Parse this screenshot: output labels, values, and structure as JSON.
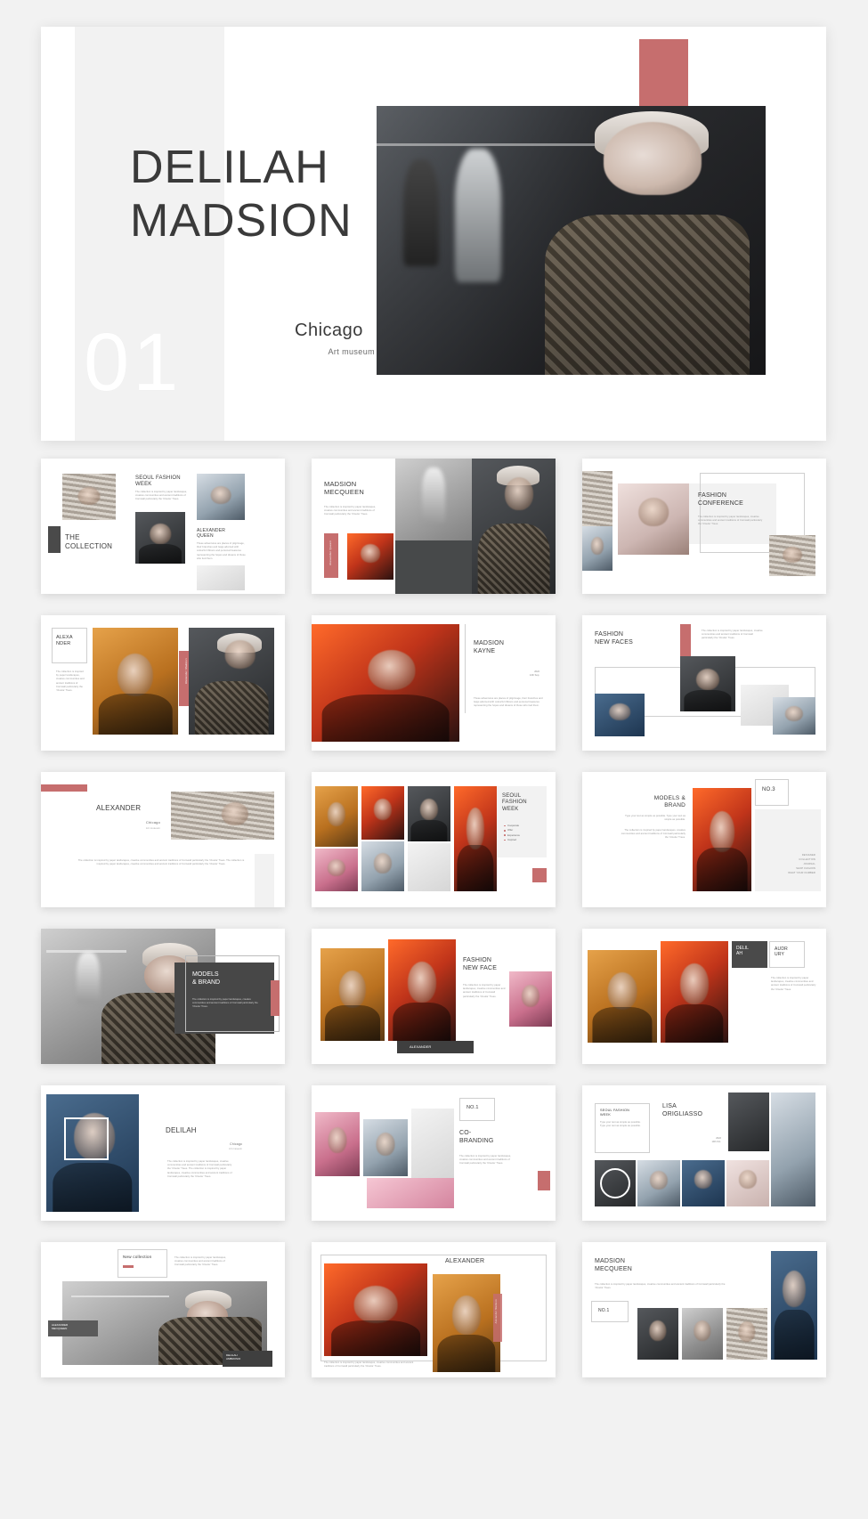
{
  "common": {
    "body_text": "The collection is inspired by paper landscapes, creative communities and ancient traditions of Cornwall particularly the 'Cloutie' Trees.",
    "body_text_long": "The collection is inspired by paper landscapes, creative communities and ancient traditions of Cornwall particularly the 'Cloutie' Trees. The collection is inspired by paper landscapes, creative communities and ancient traditions of Cornwall particularly the 'Cloutie' Trees.",
    "tip_text": "Type your text as simple as possible. Type your text as simple as possible.",
    "accent_color": "#c66e6e",
    "dark_color": "#4a4a4a",
    "text_color": "#3a3a3a"
  },
  "hero": {
    "title_line1": "DELILAH",
    "title_line2": "MADSION",
    "number": "01",
    "city": "Chicago",
    "venue": "Art museum"
  },
  "slides": [
    {
      "id": "the-collection",
      "title": "THE\nCOLLECTION",
      "heading": "SEOUL FASHION\nWEEK",
      "subheading": "ALEXANDER\nQUEEN",
      "body": "The collection is inspired by paper landscapes, creative communities and ancient traditions of Cornwall particularly the 'Cloutie' Trees.",
      "body2": "These adventures are places of pilgrimage, their branches and twigs adorned with colourful ribbons and personal treasures representing the hopes and dreams of those who tied them."
    },
    {
      "id": "madsion-mecqueen",
      "title": "MADSION\nMECQUEEN",
      "body": "The collection is inspired by paper landscapes, creative communities and ancient traditions of Cornwall particularly the 'Cloutie' Trees.",
      "ribbon": "Alexander Queen"
    },
    {
      "id": "fashion-conference",
      "title": "FASHION\nCONFERENCE",
      "body": "The collection is inspired by paper landscapes, creative communities and ancient traditions of Cornwall particularly the 'Cloutie' Trees."
    },
    {
      "id": "alexander-card",
      "title": "ALEXA\nNDER",
      "body": "The collection is inspired by paper landscapes, creative communities and ancient traditions of Cornwall particularly the 'Cloutie' Trees.",
      "ribbon": "Alexander Madsion"
    },
    {
      "id": "madsion-kayne",
      "title": "MADSION\nKAYNE",
      "date_year": "2022",
      "date_day": "12th Sep.",
      "body": "These adventures are places of pilgrimage, their branches and twigs adorned with colourful ribbons and personal treasures representing the hopes and dreams of those who tied them."
    },
    {
      "id": "fashion-new-faces",
      "title": "FASHION\nNEW FACES",
      "body": "The collection is inspired by paper landscapes, creative communities and ancient traditions of Cornwall particularly the 'Cloutie' Trees."
    },
    {
      "id": "alexander-chicago",
      "title": "ALEXANDER",
      "city": "Chicago",
      "venue": "Art museum",
      "body": "The collection is inspired by paper landscapes, creative communities and ancient traditions of Cornwall particularly the 'Cloutie' Trees. The collection is inspired by paper landscapes, creative communities and ancient traditions of Cornwall particularly the 'Cloutie' Trees."
    },
    {
      "id": "seoul-fashion-week-list",
      "title": "SEOUL\nFASHION\nWEEK",
      "bullets": [
        "Cooperate",
        "Offer",
        "Experience",
        "Inspired"
      ]
    },
    {
      "id": "models-brand-no3",
      "title": "MODELS &\nBRAND",
      "badge": "NO.3",
      "body": "Type your text as simple as possible. Type your text as simple as possible.",
      "body2": "The collection is inspired by paper landscapes, creative communities and ancient traditions of Cornwall particularly the 'Cloutie' Trees.",
      "list": [
        "DESIGNER",
        "COLLECTION",
        "JOURNAL",
        "SHOP FASHION",
        "WHAT YOUR NUMBER"
      ]
    },
    {
      "id": "models-brand",
      "title": "MODELS\n& BRAND",
      "body": "The collection is inspired by paper landscapes, creative communities and ancient traditions of Cornwall particularly the 'Cloutie' Trees."
    },
    {
      "id": "fashion-new-face",
      "title": "FASHION\nNEW FACE",
      "caption": "ALEXANDER",
      "body": "The collection is inspired by paper landscapes, creative communities and ancient traditions of Cornwall particularly the 'Cloutie' Trees."
    },
    {
      "id": "delilah-audrury",
      "tag_left": "DELIL\nAH",
      "tag_right": "AUDR\nURY",
      "body": "The collection is inspired by paper landscapes, creative communities and ancient traditions of Cornwall particularly the 'Cloutie' Trees."
    },
    {
      "id": "delilah-portrait",
      "title": "DELILAH",
      "city": "Chicago",
      "venue": "Art museum",
      "body": "The collection is inspired by paper landscapes, creative communities and ancient traditions of Cornwall particularly the 'Cloutie' Trees. The collection is inspired by paper landscapes, creative communities and ancient traditions of Cornwall particularly the 'Cloutie' Trees."
    },
    {
      "id": "co-branding",
      "badge": "NO.1",
      "title": "CO-\nBRANDING",
      "body": "The collection is inspired by paper landscapes, creative communities and ancient traditions of Cornwall particularly the 'Cloutie' Trees."
    },
    {
      "id": "lisa-origliasso",
      "title": "LISA\nORIGLIASSO",
      "panel_title": "SEOUL FASHION\nWEEK",
      "panel_body": "Type your text as simple as possible. Type your text as simple as possible.",
      "date_year": "2022",
      "date_day": "10th Oct."
    },
    {
      "id": "new-collection",
      "badge": "New collection",
      "tag_left": "ALEXANDER\nMECQUEEN",
      "tag_right": "DELILAH\nAMBROSIO",
      "body": "The collection is inspired by paper landscapes, creative communities and ancient traditions of Cornwall particularly the 'Cloutie' Trees."
    },
    {
      "id": "alexander-wide",
      "title": "ALEXANDER",
      "body": "The collection is inspired by paper landscapes, creative communities and ancient traditions of Cornwall particularly the 'Cloutie' Trees.",
      "ribbon": "Alexander Madsion"
    },
    {
      "id": "madsion-mecqueen-2",
      "title": "MADSION\nMECQUEEN",
      "badge": "NO.1",
      "body": "The collection is inspired by paper landscapes, creative communities and ancient traditions of Cornwall particularly the 'Cloutie' Trees."
    }
  ]
}
